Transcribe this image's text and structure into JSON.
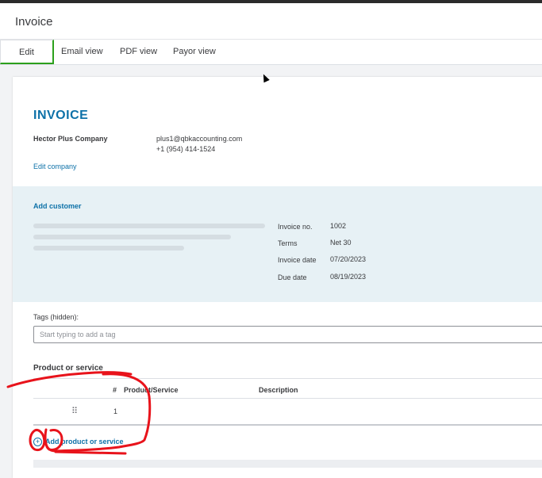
{
  "header": {
    "title": "Invoice"
  },
  "tabs": [
    {
      "label": "Edit",
      "active": true
    },
    {
      "label": "Email view"
    },
    {
      "label": "PDF view"
    },
    {
      "label": "Payor view"
    }
  ],
  "invoice": {
    "title": "INVOICE",
    "company_name": "Hector Plus Company",
    "email": "plus1@qbkaccounting.com",
    "phone": "+1 (954) 414-1524",
    "edit_company": "Edit company",
    "add_customer": "Add customer",
    "meta": [
      {
        "label": "Invoice no.",
        "value": "1002"
      },
      {
        "label": "Terms",
        "value": "Net 30"
      },
      {
        "label": "Invoice date",
        "value": "07/20/2023"
      },
      {
        "label": "Due date",
        "value": "08/19/2023"
      }
    ],
    "tags_label": "Tags (hidden):",
    "tags_placeholder": "Start typing to add a tag",
    "products": {
      "title": "Product or service",
      "columns": [
        "#",
        "Product/Service",
        "Description"
      ],
      "rows": [
        {
          "num": "1"
        }
      ],
      "add_label": "Add product or service"
    }
  },
  "colors": {
    "accent": "#0d71a8",
    "active_tab": "#2ca01c",
    "annotation": "#e8131b"
  },
  "icons": {
    "add": "plus-circle-icon",
    "drag": "drag-handle-icon"
  }
}
